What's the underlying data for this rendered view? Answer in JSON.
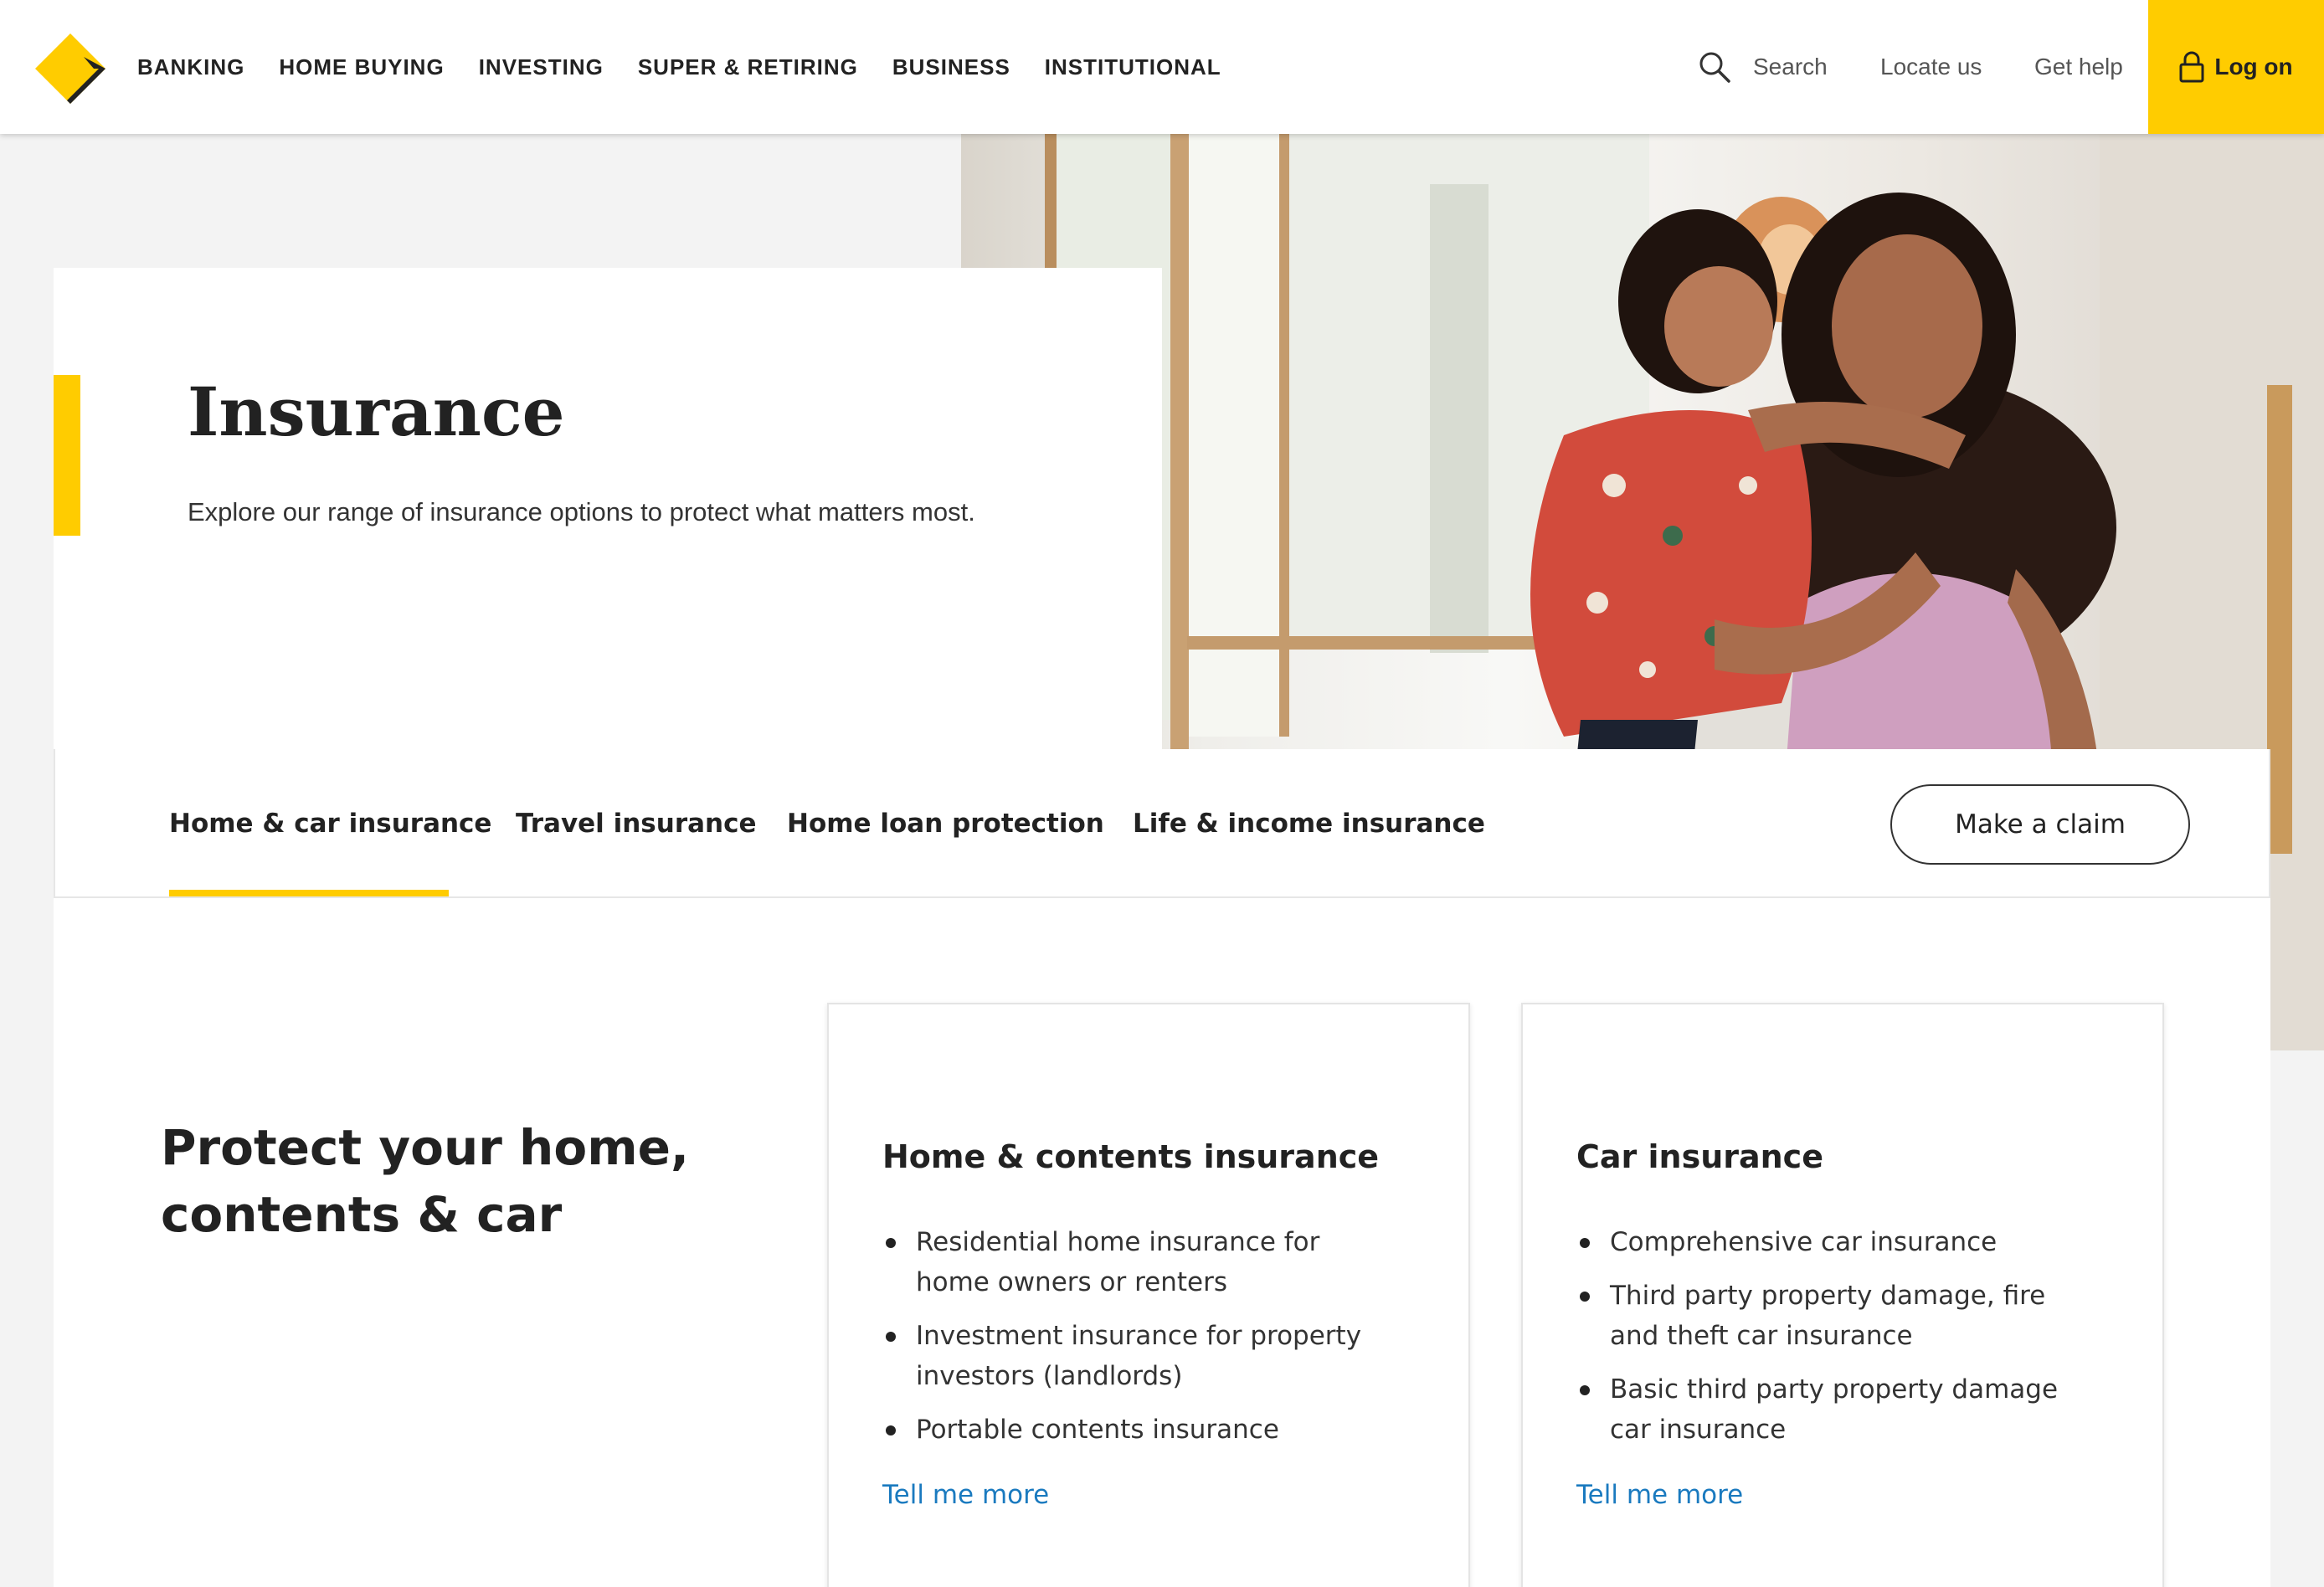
{
  "brand": {
    "yellow": "#ffcc00",
    "link_blue": "#1a7abf",
    "logo_icon": "diamond-logo-icon"
  },
  "header": {
    "nav": [
      {
        "label": "BANKING"
      },
      {
        "label": "HOME BUYING"
      },
      {
        "label": "INVESTING"
      },
      {
        "label": "SUPER & RETIRING"
      },
      {
        "label": "BUSINESS"
      },
      {
        "label": "INSTITUTIONAL"
      }
    ],
    "search_label": "Search",
    "locate_label": "Locate us",
    "help_label": "Get help",
    "logon_label": "Log on"
  },
  "hero": {
    "title": "Insurance",
    "subtitle": "Explore our range of insurance options to protect what matters most."
  },
  "tabs": {
    "items": [
      {
        "label": "Home & car insurance",
        "active": true
      },
      {
        "label": "Travel insurance",
        "active": false
      },
      {
        "label": "Home loan protection",
        "active": false
      },
      {
        "label": "Life & income insurance",
        "active": false
      }
    ],
    "claim_button": "Make a claim"
  },
  "section": {
    "title": "Protect your home, contents & car"
  },
  "cards": [
    {
      "title": "Home & contents insurance",
      "bullets": [
        "Residential home insurance for home owners or renters",
        "Investment insurance for property investors (landlords)",
        "Portable contents insurance"
      ],
      "link": "Tell me more"
    },
    {
      "title": "Car insurance",
      "bullets": [
        "Comprehensive car insurance",
        "Third party property damage, fire and theft car insurance",
        "Basic third party property damage car insurance"
      ],
      "link": "Tell me more"
    }
  ]
}
